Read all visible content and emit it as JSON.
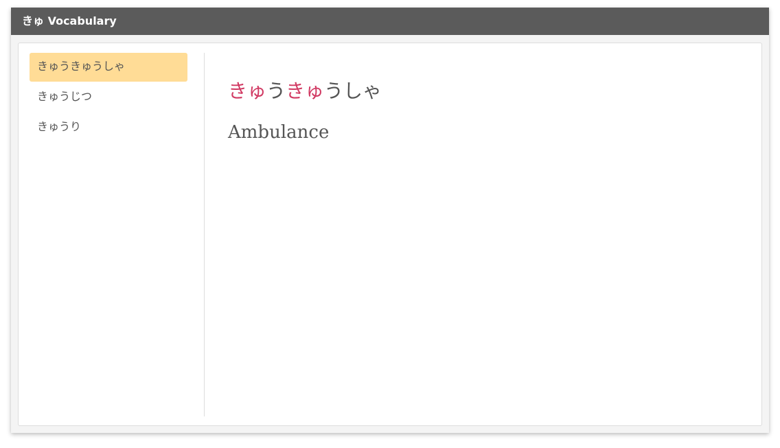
{
  "window": {
    "title": "きゅ Vocabulary"
  },
  "sidebar": {
    "items": [
      {
        "label": "きゅうきゅうしゃ",
        "selected": true
      },
      {
        "label": "きゅうじつ",
        "selected": false
      },
      {
        "label": "きゅうり",
        "selected": false
      }
    ]
  },
  "detail": {
    "word_parts": [
      {
        "text": "きゅ",
        "highlight": true
      },
      {
        "text": "う",
        "highlight": false
      },
      {
        "text": "きゅ",
        "highlight": true
      },
      {
        "text": "うしゃ",
        "highlight": false
      }
    ],
    "meaning": "Ambulance"
  },
  "colors": {
    "titlebar": "#5b5b5b",
    "selected_item": "#ffdc96",
    "highlight": "#d13a63",
    "text": "#555555"
  }
}
